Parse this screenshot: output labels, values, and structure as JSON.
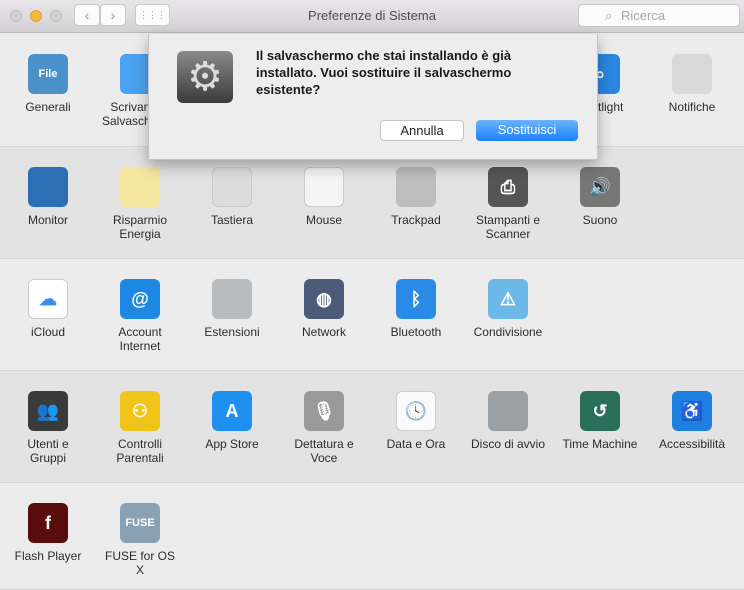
{
  "window": {
    "title": "Preferenze di Sistema",
    "search_placeholder": "Ricerca",
    "back": "‹",
    "forward": "›",
    "grid": "⋮⋮⋮"
  },
  "rows": [
    [
      {
        "label": "Generali",
        "icon": "general-icon",
        "color": "#4a90c9",
        "glyph": "File"
      },
      {
        "label": "Scrivania e Salvaschermo",
        "icon": "desktop-icon",
        "color": "#4aa3f0",
        "glyph": ""
      },
      null,
      null,
      null,
      null,
      {
        "label": "Spotlight",
        "icon": "spotlight-icon",
        "color": "#2a86e0",
        "glyph": "⌕"
      },
      {
        "label": "Notifiche",
        "icon": "notifications-icon",
        "color": "#d8d8d8",
        "glyph": ""
      }
    ],
    [
      {
        "label": "Monitor",
        "icon": "monitor-icon",
        "color": "#2c6fb5",
        "glyph": ""
      },
      {
        "label": "Risparmio Energia",
        "icon": "lightbulb-icon",
        "color": "#f5e7a0",
        "glyph": ""
      },
      {
        "label": "Tastiera",
        "icon": "keyboard-icon",
        "color": "#dcdcdc",
        "glyph": ""
      },
      {
        "label": "Mouse",
        "icon": "mouse-icon",
        "color": "#f4f4f4",
        "glyph": ""
      },
      {
        "label": "Trackpad",
        "icon": "trackpad-icon",
        "color": "#bdbdbd",
        "glyph": ""
      },
      {
        "label": "Stampanti e Scanner",
        "icon": "printer-icon",
        "color": "#555",
        "glyph": "⎙"
      },
      {
        "label": "Suono",
        "icon": "speaker-icon",
        "color": "#777",
        "glyph": "🔊"
      }
    ],
    [
      {
        "label": "iCloud",
        "icon": "icloud-icon",
        "color": "#fff",
        "glyph": "☁"
      },
      {
        "label": "Account Internet",
        "icon": "at-icon",
        "color": "#1e88e5",
        "glyph": "@"
      },
      {
        "label": "Estensioni",
        "icon": "puzzle-icon",
        "color": "#b8bcbf",
        "glyph": ""
      },
      {
        "label": "Network",
        "icon": "globe-icon",
        "color": "#4a5a78",
        "glyph": "◍"
      },
      {
        "label": "Bluetooth",
        "icon": "bluetooth-icon",
        "color": "#2a8be6",
        "glyph": "ᛒ"
      },
      {
        "label": "Condivisione",
        "icon": "sharing-folder-icon",
        "color": "#6cb8e8",
        "glyph": "⚠"
      }
    ],
    [
      {
        "label": "Utenti e Gruppi",
        "icon": "users-icon",
        "color": "#3a3a3a",
        "glyph": "👥"
      },
      {
        "label": "Controlli Parentali",
        "icon": "parental-icon",
        "color": "#f0c419",
        "glyph": "⚇"
      },
      {
        "label": "App Store",
        "icon": "appstore-icon",
        "color": "#1e90f0",
        "glyph": "A"
      },
      {
        "label": "Dettatura e Voce",
        "icon": "microphone-icon",
        "color": "#9a9a9a",
        "glyph": "🎙"
      },
      {
        "label": "Data e Ora",
        "icon": "clock-icon",
        "color": "#fafafa",
        "glyph": "🕓"
      },
      {
        "label": "Disco di avvio",
        "icon": "disk-icon",
        "color": "#9aa0a4",
        "glyph": ""
      },
      {
        "label": "Time Machine",
        "icon": "timemachine-icon",
        "color": "#2a6f5a",
        "glyph": "↺"
      },
      {
        "label": "Accessibilità",
        "icon": "accessibility-icon",
        "color": "#1d7fe0",
        "glyph": "♿"
      }
    ],
    [
      {
        "label": "Flash Player",
        "icon": "flash-icon",
        "color": "#5a0d0d",
        "glyph": "f"
      },
      {
        "label": "FUSE for OS X",
        "icon": "fuse-icon",
        "color": "#8aa0b4",
        "glyph": "FUSE"
      }
    ]
  ],
  "dialog": {
    "message": "Il salvaschermo che stai installando è già installato. Vuoi sostituire il salvaschermo esistente?",
    "cancel": "Annulla",
    "confirm": "Sostituisci"
  }
}
